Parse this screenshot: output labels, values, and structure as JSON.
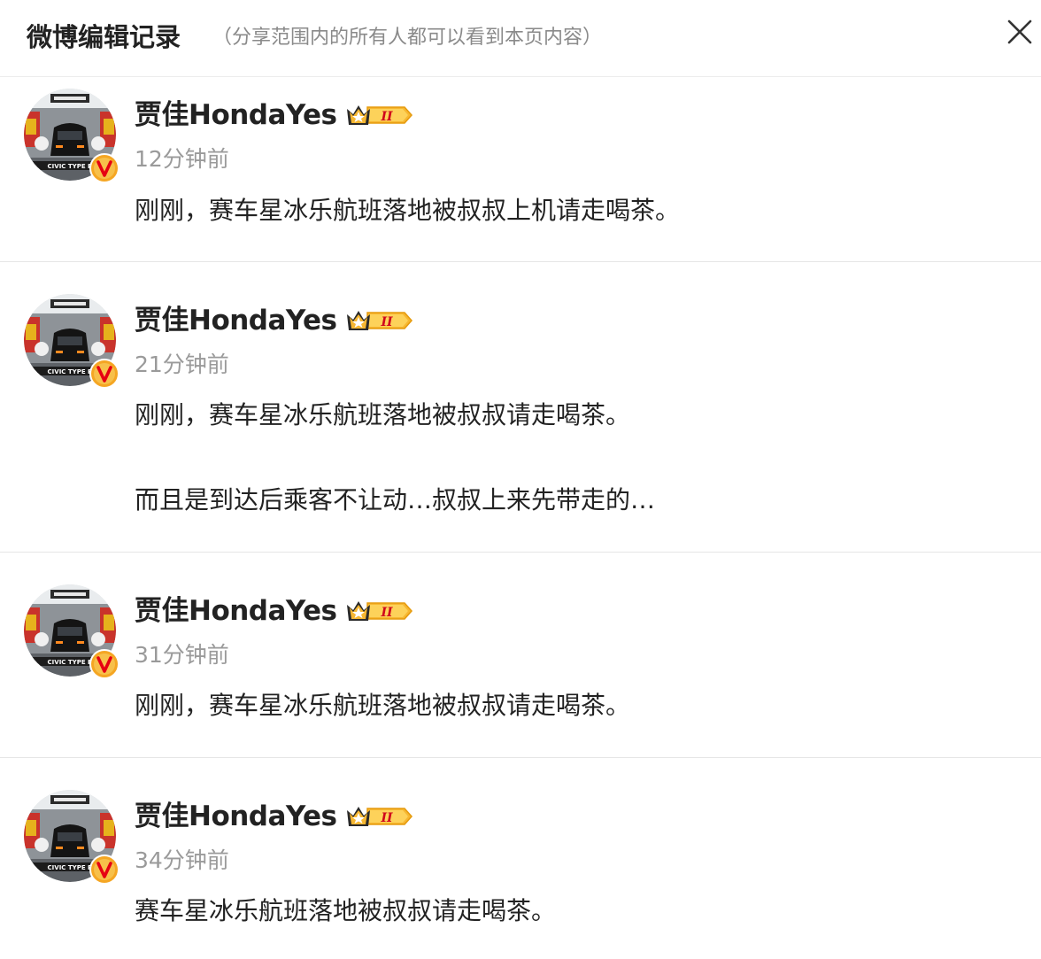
{
  "header": {
    "title": "微博编辑记录",
    "subtitle": "（分享范围内的所有人都可以看到本页内容）",
    "close_icon": "close-icon"
  },
  "entries": [
    {
      "author": "贾佳HondaYes",
      "time": "12分钟前",
      "paragraphs": [
        "刚刚，赛车星冰乐航班落地被叔叔上机请走喝茶。"
      ]
    },
    {
      "author": "贾佳HondaYes",
      "time": "21分钟前",
      "paragraphs": [
        "刚刚，赛车星冰乐航班落地被叔叔请走喝茶。",
        "而且是到达后乘客不让动…叔叔上来先带走的…"
      ]
    },
    {
      "author": "贾佳HondaYes",
      "time": "31分钟前",
      "paragraphs": [
        "刚刚，赛车星冰乐航班落地被叔叔请走喝茶。"
      ]
    },
    {
      "author": "贾佳HondaYes",
      "time": "34分钟前",
      "paragraphs": [
        "赛车星冰乐航班落地被叔叔请走喝茶。"
      ]
    }
  ],
  "badges": {
    "vip_level": "II",
    "verified_mark": "V",
    "avatar_text": "CIVIC TYPE R"
  },
  "colors": {
    "verified_badge": "#f5a623",
    "verified_mark": "#e60012",
    "vip_gold": "#f7b731",
    "time_gray": "#9a9a9a",
    "subtitle_gray": "#8a8a8a"
  }
}
